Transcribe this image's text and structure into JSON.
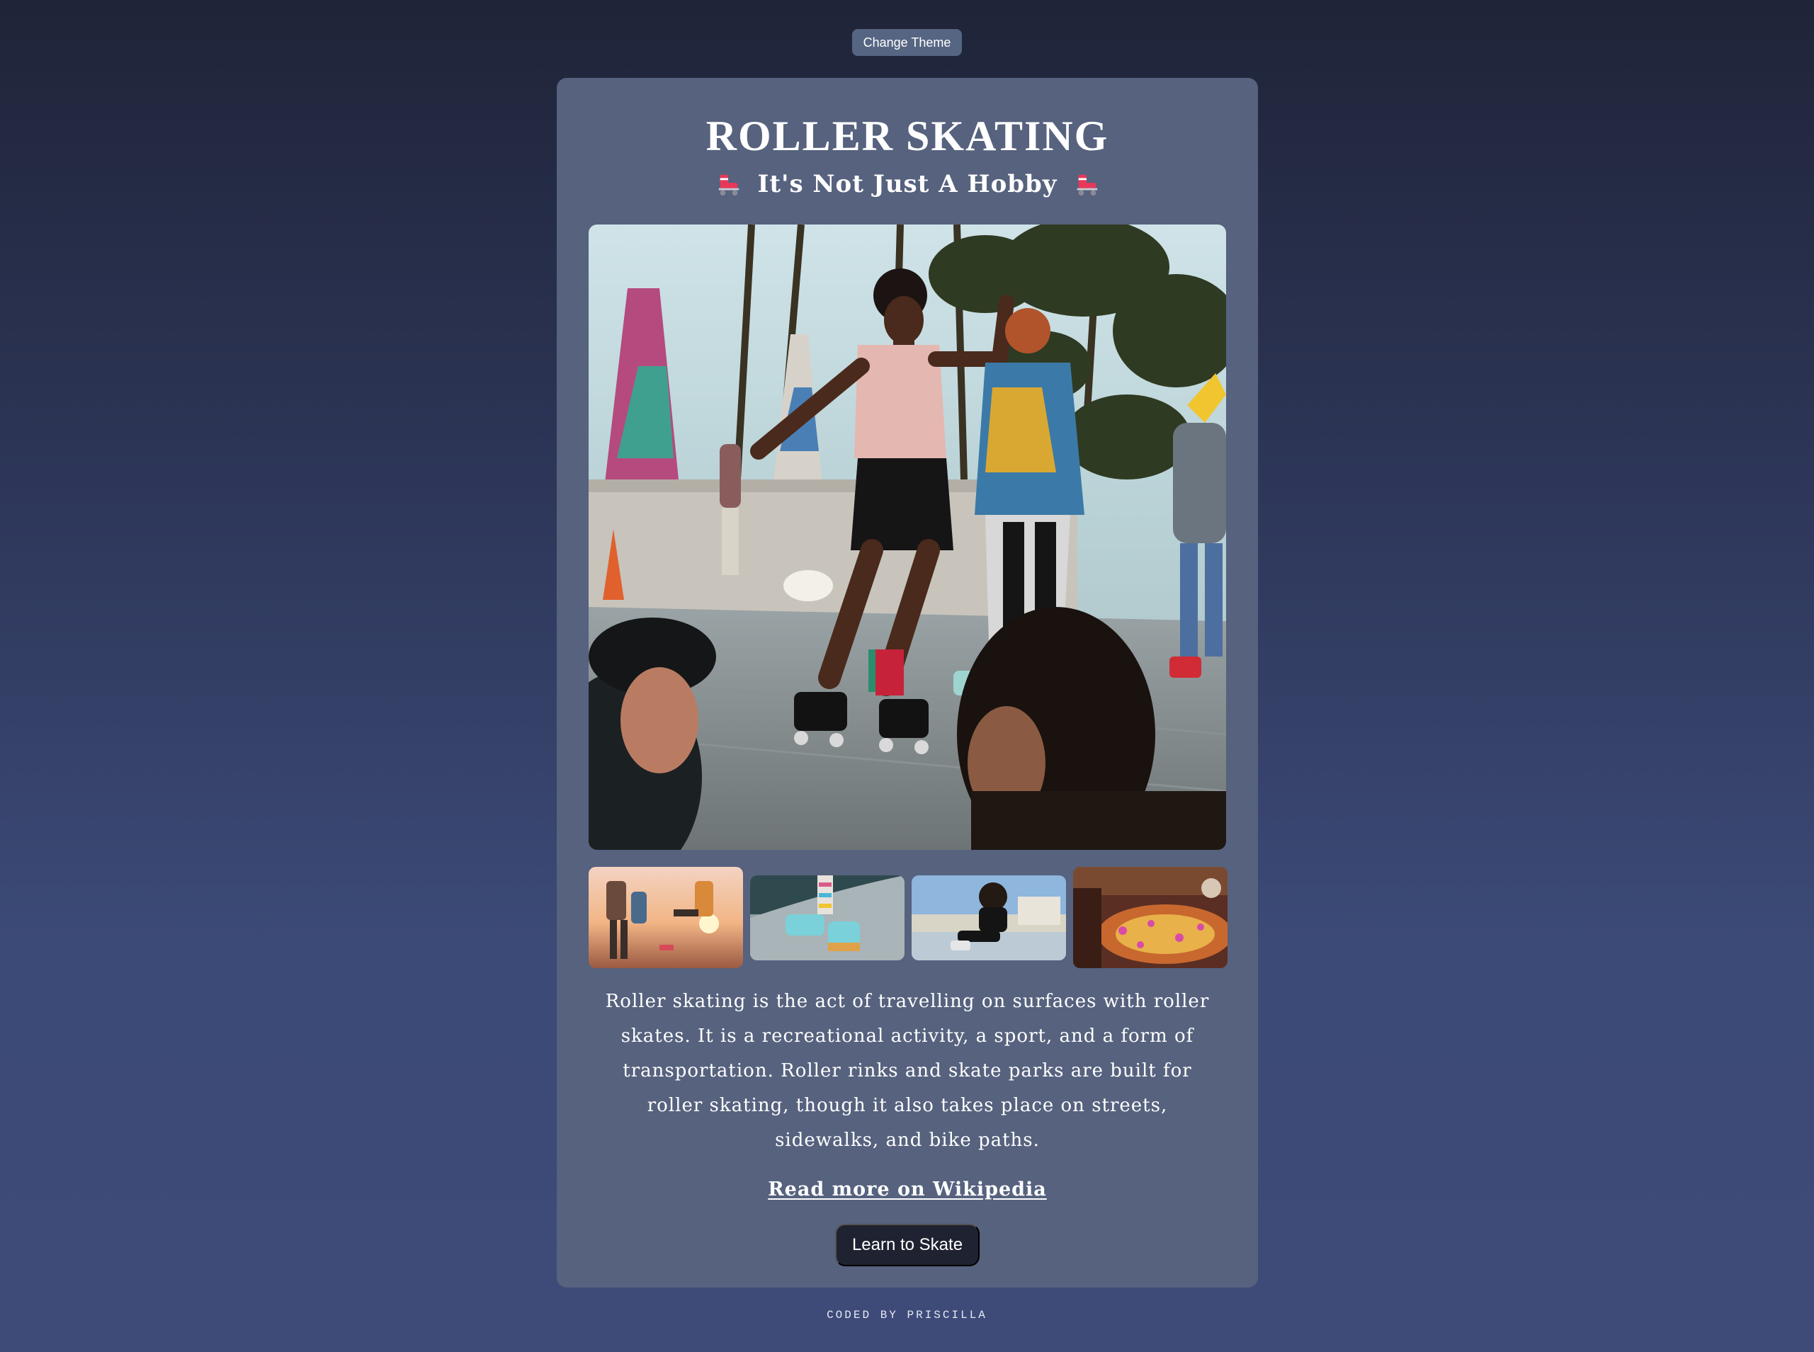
{
  "header": {
    "theme_button": "Change Theme"
  },
  "card": {
    "title": "ROLLER SKATING",
    "subtitle": "It's Not Just A Hobby",
    "subtitle_icon": "roller-skate-icon",
    "hero_image": "woman-roller-skating-on-boardwalk",
    "thumbnails": [
      {
        "name": "thumbnail-sunset-skaters"
      },
      {
        "name": "thumbnail-skate-ramp"
      },
      {
        "name": "thumbnail-skater-sitting"
      },
      {
        "name": "thumbnail-roller-rink"
      }
    ],
    "description": "Roller skating is the act of travelling on surfaces with roller skates. It is a recreational activity, a sport, and a form of transportation. Roller rinks and skate parks are built for roller skating, though it also takes place on streets, sidewalks, and bike paths.",
    "wiki_link": "Read more on Wikipedia",
    "cta_button": "Learn to Skate"
  },
  "footer": {
    "credit": "CODED BY PRISCILLA"
  },
  "colors": {
    "background_top": "#1f2438",
    "background_bottom": "#3e4b79",
    "card": "#56627e",
    "button_dark": "#1f2230",
    "accent_skate": "#e8385a"
  }
}
